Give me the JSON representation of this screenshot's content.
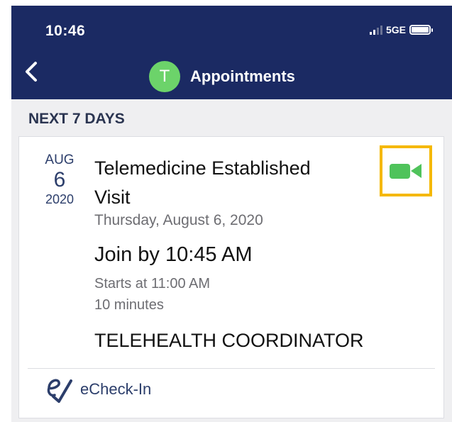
{
  "status_bar": {
    "time": "10:46",
    "network": "5GE"
  },
  "nav": {
    "avatar_letter": "T",
    "title": "Appointments"
  },
  "section": {
    "header": "NEXT 7 DAYS"
  },
  "appointment": {
    "month": "AUG",
    "day": "6",
    "year": "2020",
    "title": "Telemedicine Established Visit",
    "full_date": "Thursday, August 6, 2020",
    "join_by": "Join by 10:45 AM",
    "starts_at": "Starts at 11:00 AM",
    "duration": "10 minutes",
    "provider": "TELEHEALTH COORDINATOR",
    "video_icon": "video-camera-icon"
  },
  "actions": {
    "echeck_label": "eCheck-In"
  },
  "colors": {
    "header_bg": "#1b2a63",
    "avatar": "#6cd36a",
    "video_icon": "#4fc35b",
    "highlight": "#f5b800",
    "accent_text": "#2c3e6b"
  }
}
